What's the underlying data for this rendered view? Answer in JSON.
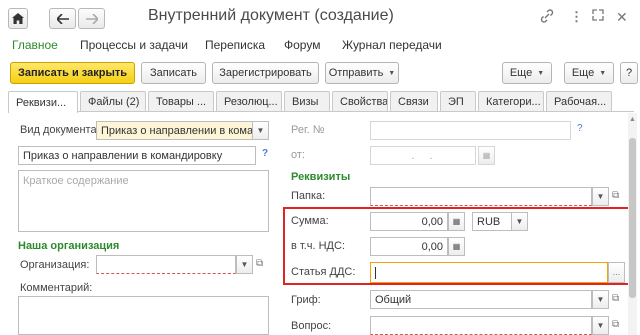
{
  "window": {
    "title": "Внутренний документ (создание)",
    "home_icon": "home-icon",
    "back_icon": "arrow-left-icon",
    "forward_icon": "arrow-right-icon",
    "link_icon": "link-icon",
    "more_icon": "kebab-icon",
    "expand_icon": "expand-icon",
    "close_icon": "close-icon"
  },
  "sections": [
    "Главное",
    "Процессы и задачи",
    "Переписка",
    "Форум",
    "Журнал передачи"
  ],
  "toolbar": {
    "save_close": "Записать и закрыть",
    "save": "Записать",
    "register": "Зарегистрировать",
    "send": "Отправить",
    "more1": "Еще",
    "more2": "Еще",
    "help": "?"
  },
  "tabs": [
    "Реквизи...",
    "Файлы (2)",
    "Товары ...",
    "Резолюц...",
    "Визы",
    "Свойства",
    "Связи",
    "ЭП",
    "Категори...",
    "Рабочая..."
  ],
  "left": {
    "doc_type_label": "Вид документа:",
    "doc_type_value": "Приказ о направлении в команд",
    "title_value": "Приказ о направлении  в командировку",
    "summary_placeholder": "Краткое содержание",
    "org_group": "Наша организация",
    "org_label": "Организация:",
    "comment_label": "Комментарий:"
  },
  "right": {
    "reg_label": "Рег. №",
    "from_label": "от:",
    "date_placeholder": ". .",
    "requisites_group": "Реквизиты",
    "folder_label": "Папка:",
    "sum_label": "Сумма:",
    "sum_value": "0,00",
    "currency": "RUB",
    "vat_label": "в т.ч. НДС:",
    "vat_value": "0,00",
    "dds_label": "Статья ДДС:",
    "grif_label": "Гриф:",
    "grif_value": "Общий",
    "question_label": "Вопрос:"
  },
  "colors": {
    "accent_green": "#2c8b2c",
    "primary_button": "#f5cf13",
    "highlight_red": "#e02424",
    "focus_orange": "#f0a30a"
  }
}
